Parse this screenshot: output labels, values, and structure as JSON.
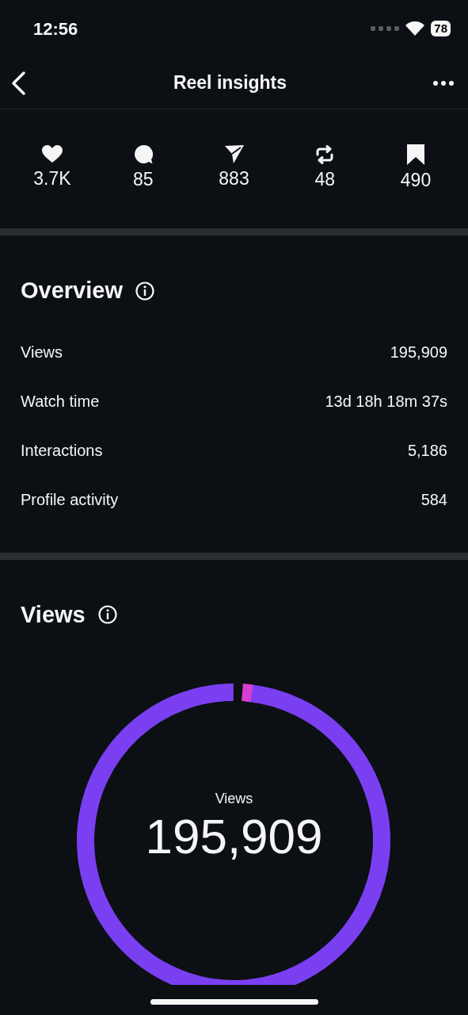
{
  "status_bar": {
    "time": "12:56",
    "battery": "78"
  },
  "header": {
    "title": "Reel insights"
  },
  "stats": [
    {
      "kind": "heart",
      "value": "3.7K"
    },
    {
      "kind": "comment",
      "value": "85"
    },
    {
      "kind": "share",
      "value": "883"
    },
    {
      "kind": "repost",
      "value": "48"
    },
    {
      "kind": "save",
      "value": "490"
    }
  ],
  "overview": {
    "title": "Overview",
    "rows": [
      {
        "label": "Views",
        "value": "195,909"
      },
      {
        "label": "Watch time",
        "value": "13d 18h 18m 37s"
      },
      {
        "label": "Interactions",
        "value": "5,186"
      },
      {
        "label": "Profile activity",
        "value": "584"
      }
    ]
  },
  "views": {
    "title": "Views",
    "center_label": "Views",
    "center_value": "195,909"
  }
}
